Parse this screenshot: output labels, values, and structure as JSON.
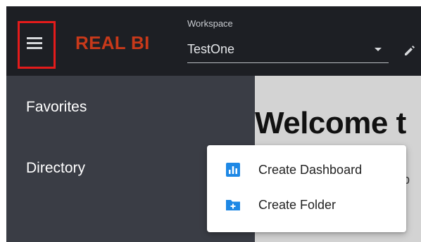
{
  "header": {
    "brand": "REAL BI",
    "workspace_label": "Workspace",
    "workspace_value": "TestOne",
    "menu_icon": "hamburger-icon",
    "edit_icon": "pencil-icon"
  },
  "sidebar": {
    "items": [
      {
        "label": "Favorites"
      },
      {
        "label": "Directory"
      }
    ]
  },
  "main": {
    "welcome_text": "Welcome t",
    "hint_text": "nb"
  },
  "menu": {
    "items": [
      {
        "label": "Create Dashboard",
        "icon": "dashboard-icon"
      },
      {
        "label": "Create Folder",
        "icon": "folder-add-icon"
      }
    ]
  },
  "colors": {
    "topbar": "#1d1f24",
    "sidebar": "#3a3d45",
    "brand": "#c8391a",
    "highlight": "#e41b1b",
    "icon_blue": "#1e88e5"
  }
}
